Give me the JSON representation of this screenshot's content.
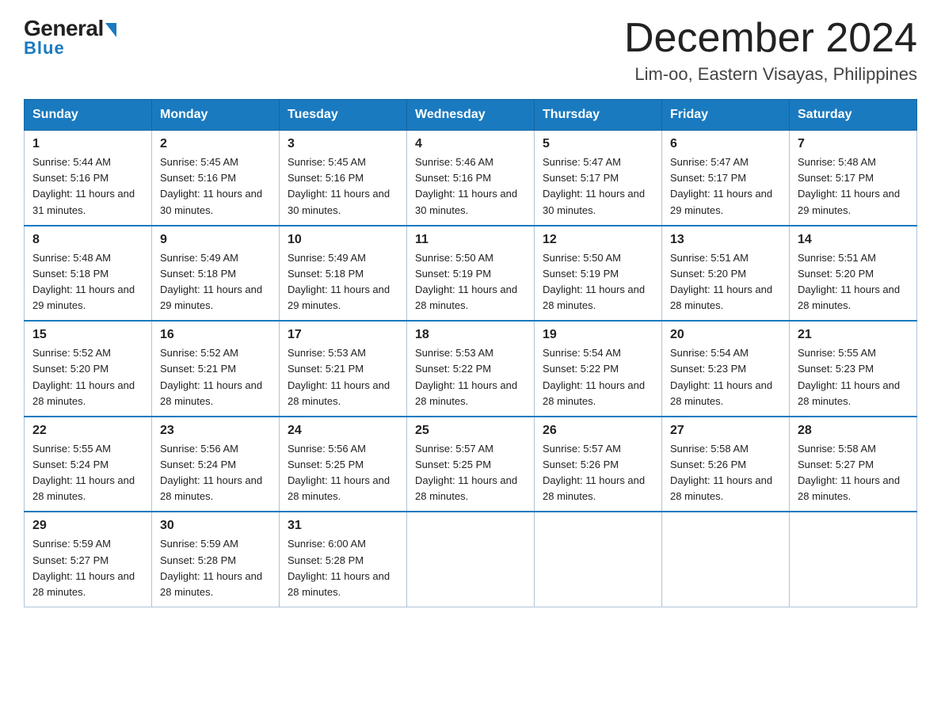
{
  "header": {
    "logo_general": "General",
    "logo_blue": "Blue",
    "month_title": "December 2024",
    "location": "Lim-oo, Eastern Visayas, Philippines"
  },
  "weekdays": [
    "Sunday",
    "Monday",
    "Tuesday",
    "Wednesday",
    "Thursday",
    "Friday",
    "Saturday"
  ],
  "weeks": [
    [
      {
        "day": "1",
        "sunrise": "5:44 AM",
        "sunset": "5:16 PM",
        "daylight": "11 hours and 31 minutes."
      },
      {
        "day": "2",
        "sunrise": "5:45 AM",
        "sunset": "5:16 PM",
        "daylight": "11 hours and 30 minutes."
      },
      {
        "day": "3",
        "sunrise": "5:45 AM",
        "sunset": "5:16 PM",
        "daylight": "11 hours and 30 minutes."
      },
      {
        "day": "4",
        "sunrise": "5:46 AM",
        "sunset": "5:16 PM",
        "daylight": "11 hours and 30 minutes."
      },
      {
        "day": "5",
        "sunrise": "5:47 AM",
        "sunset": "5:17 PM",
        "daylight": "11 hours and 30 minutes."
      },
      {
        "day": "6",
        "sunrise": "5:47 AM",
        "sunset": "5:17 PM",
        "daylight": "11 hours and 29 minutes."
      },
      {
        "day": "7",
        "sunrise": "5:48 AM",
        "sunset": "5:17 PM",
        "daylight": "11 hours and 29 minutes."
      }
    ],
    [
      {
        "day": "8",
        "sunrise": "5:48 AM",
        "sunset": "5:18 PM",
        "daylight": "11 hours and 29 minutes."
      },
      {
        "day": "9",
        "sunrise": "5:49 AM",
        "sunset": "5:18 PM",
        "daylight": "11 hours and 29 minutes."
      },
      {
        "day": "10",
        "sunrise": "5:49 AM",
        "sunset": "5:18 PM",
        "daylight": "11 hours and 29 minutes."
      },
      {
        "day": "11",
        "sunrise": "5:50 AM",
        "sunset": "5:19 PM",
        "daylight": "11 hours and 28 minutes."
      },
      {
        "day": "12",
        "sunrise": "5:50 AM",
        "sunset": "5:19 PM",
        "daylight": "11 hours and 28 minutes."
      },
      {
        "day": "13",
        "sunrise": "5:51 AM",
        "sunset": "5:20 PM",
        "daylight": "11 hours and 28 minutes."
      },
      {
        "day": "14",
        "sunrise": "5:51 AM",
        "sunset": "5:20 PM",
        "daylight": "11 hours and 28 minutes."
      }
    ],
    [
      {
        "day": "15",
        "sunrise": "5:52 AM",
        "sunset": "5:20 PM",
        "daylight": "11 hours and 28 minutes."
      },
      {
        "day": "16",
        "sunrise": "5:52 AM",
        "sunset": "5:21 PM",
        "daylight": "11 hours and 28 minutes."
      },
      {
        "day": "17",
        "sunrise": "5:53 AM",
        "sunset": "5:21 PM",
        "daylight": "11 hours and 28 minutes."
      },
      {
        "day": "18",
        "sunrise": "5:53 AM",
        "sunset": "5:22 PM",
        "daylight": "11 hours and 28 minutes."
      },
      {
        "day": "19",
        "sunrise": "5:54 AM",
        "sunset": "5:22 PM",
        "daylight": "11 hours and 28 minutes."
      },
      {
        "day": "20",
        "sunrise": "5:54 AM",
        "sunset": "5:23 PM",
        "daylight": "11 hours and 28 minutes."
      },
      {
        "day": "21",
        "sunrise": "5:55 AM",
        "sunset": "5:23 PM",
        "daylight": "11 hours and 28 minutes."
      }
    ],
    [
      {
        "day": "22",
        "sunrise": "5:55 AM",
        "sunset": "5:24 PM",
        "daylight": "11 hours and 28 minutes."
      },
      {
        "day": "23",
        "sunrise": "5:56 AM",
        "sunset": "5:24 PM",
        "daylight": "11 hours and 28 minutes."
      },
      {
        "day": "24",
        "sunrise": "5:56 AM",
        "sunset": "5:25 PM",
        "daylight": "11 hours and 28 minutes."
      },
      {
        "day": "25",
        "sunrise": "5:57 AM",
        "sunset": "5:25 PM",
        "daylight": "11 hours and 28 minutes."
      },
      {
        "day": "26",
        "sunrise": "5:57 AM",
        "sunset": "5:26 PM",
        "daylight": "11 hours and 28 minutes."
      },
      {
        "day": "27",
        "sunrise": "5:58 AM",
        "sunset": "5:26 PM",
        "daylight": "11 hours and 28 minutes."
      },
      {
        "day": "28",
        "sunrise": "5:58 AM",
        "sunset": "5:27 PM",
        "daylight": "11 hours and 28 minutes."
      }
    ],
    [
      {
        "day": "29",
        "sunrise": "5:59 AM",
        "sunset": "5:27 PM",
        "daylight": "11 hours and 28 minutes."
      },
      {
        "day": "30",
        "sunrise": "5:59 AM",
        "sunset": "5:28 PM",
        "daylight": "11 hours and 28 minutes."
      },
      {
        "day": "31",
        "sunrise": "6:00 AM",
        "sunset": "5:28 PM",
        "daylight": "11 hours and 28 minutes."
      },
      null,
      null,
      null,
      null
    ]
  ]
}
